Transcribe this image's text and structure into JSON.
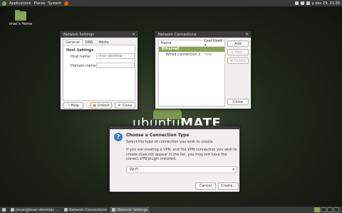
{
  "top_panel": {
    "menus": [
      "Applications",
      "Places",
      "System"
    ],
    "clock": "p dec 29, 21:38"
  },
  "desktop": {
    "home_icon_label": "imac's Home"
  },
  "wallpaper": {
    "brand_light": "ubuntu",
    "brand_bold": "MATE"
  },
  "network_settings": {
    "title": "Network Settings",
    "tabs": [
      "General",
      "DNS",
      "Hosts"
    ],
    "section": "Host Settings",
    "host_name_label": "Host name:",
    "host_name_value": "imac-desktop",
    "domain_label": "Domain name:",
    "domain_value": "",
    "help_label": "Help",
    "unlock_label": "Unlock",
    "close_label": "Close"
  },
  "network_connections": {
    "title": "Network Connections",
    "col_name": "Name",
    "col_last_used": "Last Used",
    "group": "Ethernet",
    "connection_name": "Wired connection 1",
    "connection_last_used": "now",
    "add_label": "Add",
    "edit_label": "Edit...",
    "delete_label": "Delete",
    "close_label": "Close"
  },
  "dialog": {
    "title": "Choose a Connection Type",
    "text1": "Select the type of connection you wish to create.",
    "text2": "If you are creating a VPN, and the VPN connection you wish to create does not appear in the list, you may not have the correct VPN plugin installed.",
    "selected_type": "Wi-Fi",
    "cancel_label": "Cancel",
    "create_label": "Create..."
  },
  "taskbar": {
    "items": [
      "[imac@imac-desktop: ...",
      "Network Connections",
      "Network Settings"
    ]
  },
  "colors": {
    "accent": "#87a556",
    "panel": "#3a3a3a"
  }
}
